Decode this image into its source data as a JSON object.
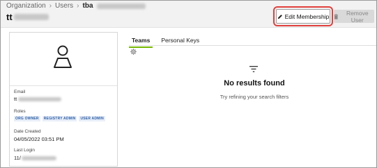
{
  "breadcrumb": {
    "root": "Organization",
    "level1": "Users",
    "current": "tba"
  },
  "page": {
    "title_prefix": "tt"
  },
  "actions": {
    "edit_label": "Edit Membership",
    "remove_label": "Remove User"
  },
  "profile": {
    "email_label": "Email",
    "email_prefix": "tt",
    "roles_label": "Roles",
    "roles": [
      "ORG OWNER",
      "REGISTRY ADMIN",
      "USER ADMIN"
    ],
    "date_label": "Date Created",
    "date_value": "04/05/2022 03:51 PM",
    "login_label": "Last Login",
    "login_prefix": "11/"
  },
  "tabs": [
    "Teams",
    "Personal Keys"
  ],
  "active_tab": "Teams",
  "empty_state": {
    "title": "No results found",
    "subtitle": "Try refining your search filters"
  },
  "colors": {
    "accent": "#76b900",
    "highlight": "#e0403c",
    "role_badge": "#2c5fa8"
  },
  "icons": {
    "edit": "pencil-icon",
    "remove": "trash-icon",
    "settings": "gear-icon",
    "filter": "filter-icon",
    "avatar": "user-icon"
  }
}
